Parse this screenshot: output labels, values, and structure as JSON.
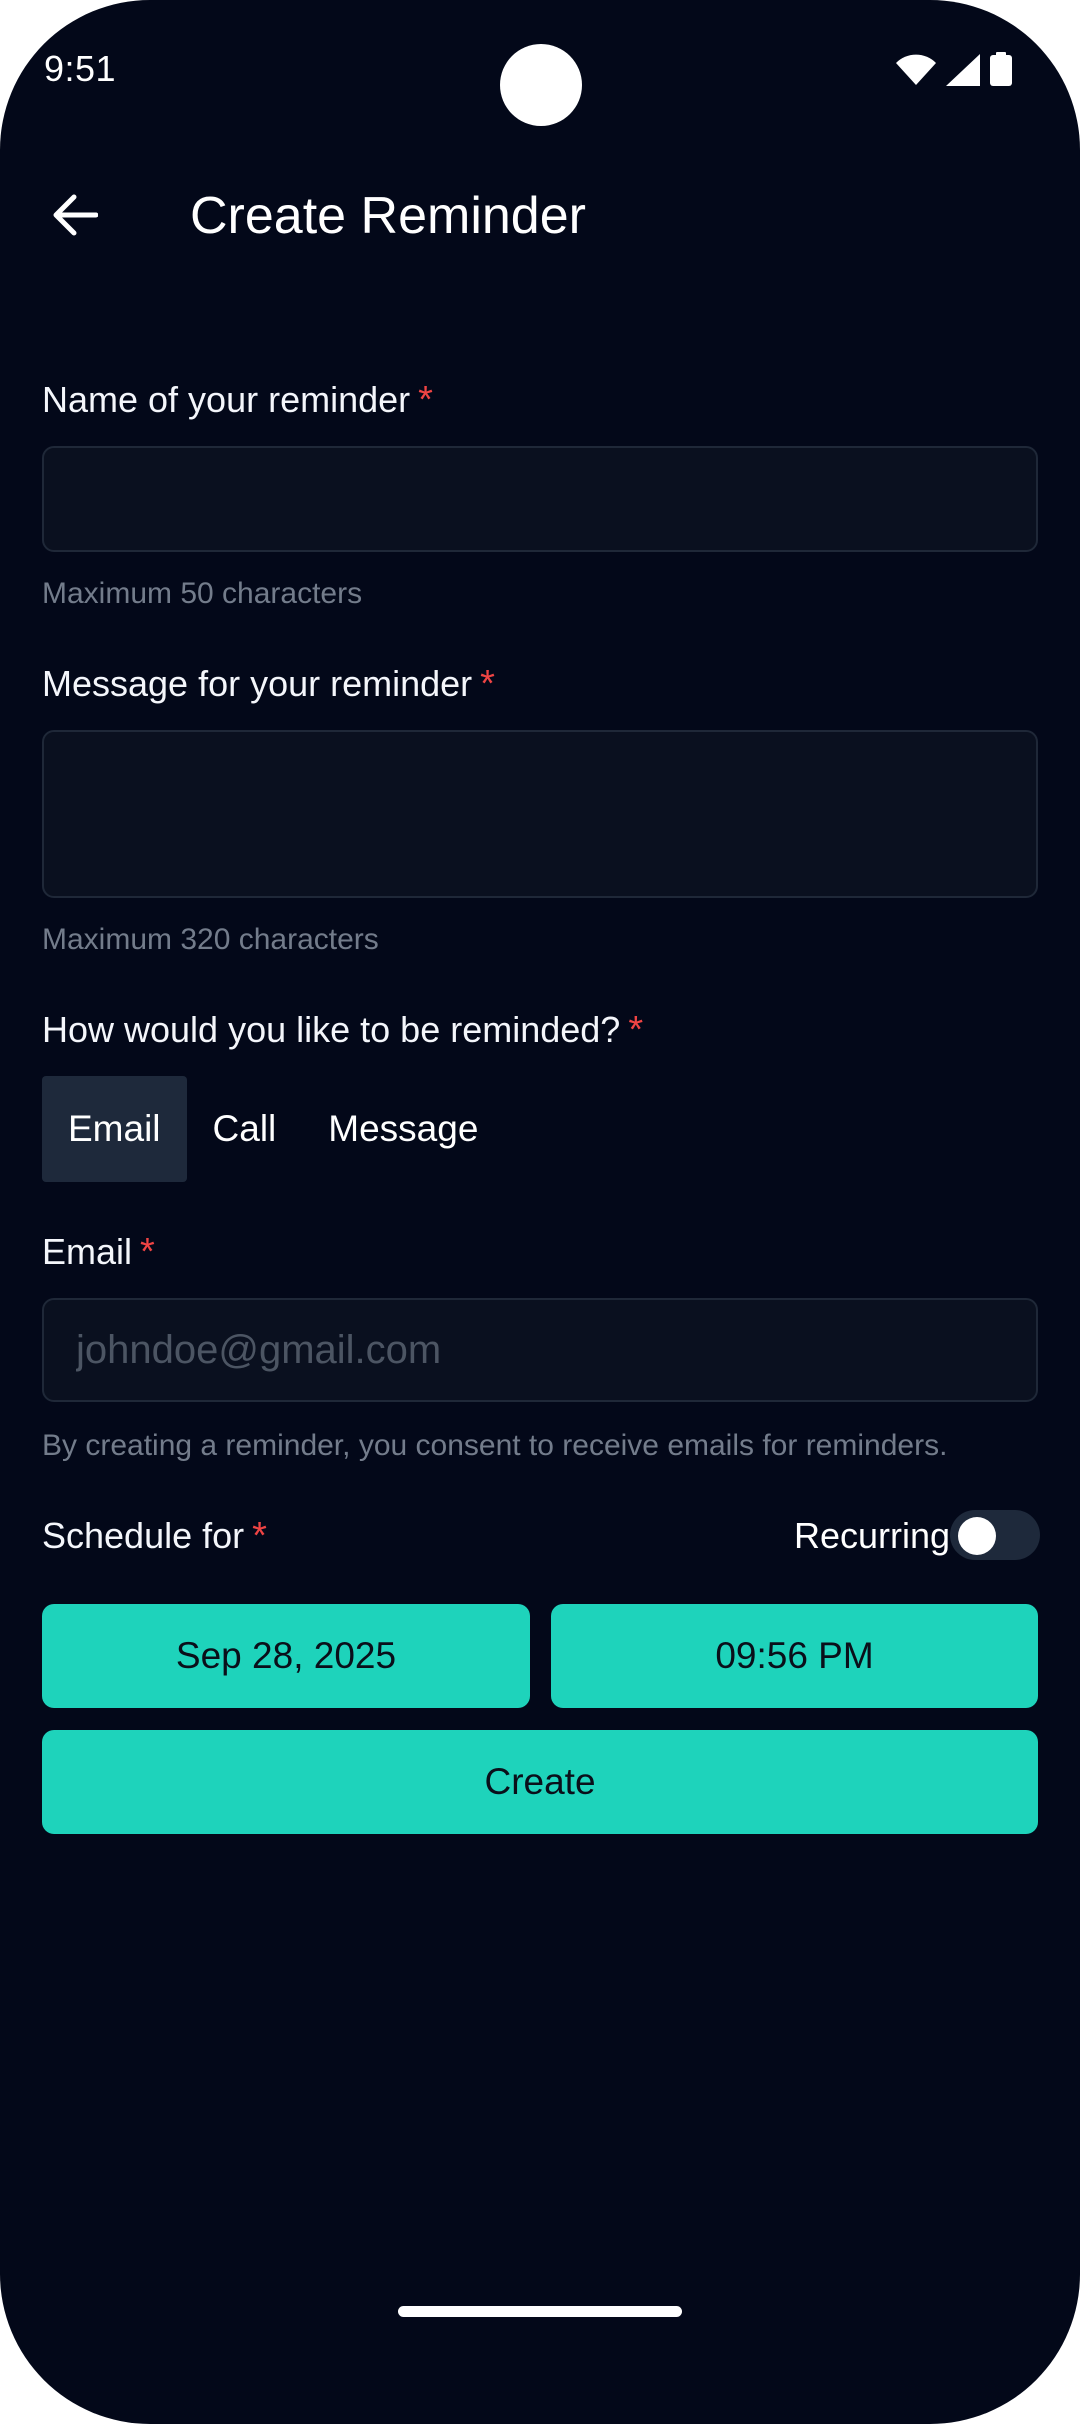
{
  "status_bar": {
    "time": "9:51",
    "icons": [
      "wifi-icon",
      "signal-icon",
      "battery-icon"
    ]
  },
  "app_bar": {
    "back_icon": "arrow-back-icon",
    "title": "Create Reminder"
  },
  "form": {
    "name": {
      "label": "Name of your reminder",
      "required_mark": "*",
      "value": "",
      "helper": "Maximum 50 characters"
    },
    "message": {
      "label": "Message for your reminder",
      "required_mark": "*",
      "value": "",
      "helper": "Maximum 320 characters"
    },
    "method": {
      "label": "How would you like to be reminded?",
      "required_mark": "*",
      "options": [
        "Email",
        "Call",
        "Message"
      ],
      "selected": "Email"
    },
    "email": {
      "label": "Email",
      "required_mark": "*",
      "value": "",
      "placeholder": "johndoe@gmail.com",
      "helper": "By creating a reminder, you consent to receive emails for reminders."
    },
    "schedule": {
      "label": "Schedule for",
      "required_mark": "*",
      "recurring_label": "Recurring",
      "recurring_on": false,
      "date": "Sep 28, 2025",
      "time": "09:56 PM"
    },
    "create_label": "Create"
  },
  "colors": {
    "background": "#030819",
    "accent": "#1ed3bb",
    "required": "#ef4444",
    "field_bg": "#0a101f",
    "helper_text": "#737c8b"
  }
}
